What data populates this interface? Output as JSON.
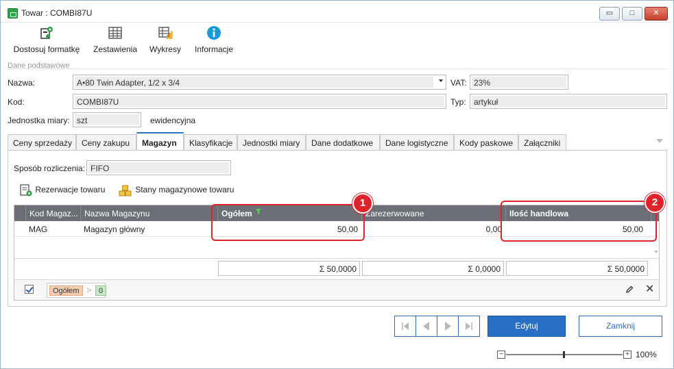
{
  "window": {
    "title": "Towar : COMBI87U",
    "controls": {
      "minimize": "▭",
      "maximize": "□",
      "close": "✕"
    }
  },
  "toolbar": {
    "items": [
      {
        "label": "Dostosuj formatkę",
        "icon": "customize-form-icon"
      },
      {
        "label": "Zestawienia",
        "icon": "table-grid-icon"
      },
      {
        "label": "Wykresy",
        "icon": "chart-table-icon"
      },
      {
        "label": "Informacje",
        "icon": "info-icon"
      }
    ]
  },
  "basic_data": {
    "section_label": "Dane podstawowe",
    "name_label": "Nazwa:",
    "name_value": "A•80 Twin Adapter, 1/2 x 3/4",
    "vat_label": "VAT:",
    "vat_value": "23%",
    "code_label": "Kod:",
    "code_value": "COMBI87U",
    "type_label": "Typ:",
    "type_value": "artykuł",
    "unit_label": "Jednostka miary:",
    "unit_value": "szt",
    "unit_suffix": "ewidencyjna"
  },
  "tabs": [
    {
      "label": "Ceny sprzedaży",
      "active": false
    },
    {
      "label": "Ceny zakupu",
      "active": false
    },
    {
      "label": "Magazyn",
      "active": true
    },
    {
      "label": "Klasyfikacje",
      "active": false
    },
    {
      "label": "Jednostki miary",
      "active": false
    },
    {
      "label": "Dane dodatkowe",
      "active": false
    },
    {
      "label": "Dane logistyczne",
      "active": false
    },
    {
      "label": "Kody paskowe",
      "active": false
    },
    {
      "label": "Załączniki",
      "active": false
    }
  ],
  "warehouse": {
    "settlement_label": "Sposób rozliczenia:",
    "settlement_value": "FIFO",
    "reservations_link": "Rezerwacje towaru",
    "stock_link": "Stany magazynowe towaru",
    "columns": [
      "Kod Magaz...",
      "Nazwa Magazynu",
      "Ogółem",
      "Zarezerwowane",
      "Ilość handlowa"
    ],
    "rows": [
      {
        "code": "MAG",
        "name": "Magazyn główny",
        "total": "50,00",
        "reserved": "0,00",
        "tradable": "50,00"
      }
    ],
    "sums": {
      "total": "Σ 50,0000",
      "reserved": "Σ 0,0000",
      "tradable": "Σ 50,0000"
    },
    "filter": {
      "field": "Ogółem",
      "operator": ">",
      "value": "0"
    },
    "callouts": [
      "1",
      "2"
    ]
  },
  "navigation": {
    "first": "first-record-icon",
    "prev": "previous-record-icon",
    "next": "next-record-icon",
    "last": "last-record-icon"
  },
  "buttons": {
    "edit": "Edytuj",
    "close": "Zamknij"
  },
  "zoom": {
    "minus": "−",
    "plus": "+",
    "level": "100%",
    "value_percent": 100
  },
  "colors": {
    "accent": "#2a6fc6",
    "header": "#6c6f76",
    "highlight": "#e0232b"
  }
}
